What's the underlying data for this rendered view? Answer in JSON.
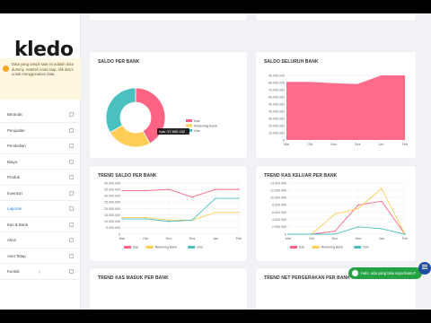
{
  "app": {
    "logo": "kledo"
  },
  "notice": {
    "text": "Data yang tampil saat ini adalah data dummy. Setelah Anda siap, klik disini untuk menggunakan data."
  },
  "sidebar": {
    "items": [
      {
        "label": "Beranda"
      },
      {
        "label": "Penjualan"
      },
      {
        "label": "Pembelian"
      },
      {
        "label": "Biaya"
      },
      {
        "label": "Produk"
      },
      {
        "label": "Inventori"
      },
      {
        "label": "Laporan",
        "active": true
      },
      {
        "label": "Kas & Bank"
      },
      {
        "label": "Akun"
      },
      {
        "label": "Aset Tetap"
      },
      {
        "label": "Kontak"
      }
    ],
    "collapse_icon": "chevron-left-icon"
  },
  "cards": {
    "saldo_per_bank": {
      "title": "SALDO PER BANK",
      "tooltip": "Kas: 37.680.152"
    },
    "saldo_seluruh_bank": {
      "title": "SALDO SELURUH BANK"
    },
    "trend_saldo_per_bank": {
      "title": "TREND SALDO PER BANK"
    },
    "trend_kas_keluar": {
      "title": "TREND KAS KELUAR PER BANK"
    },
    "trend_kas_masuk": {
      "title": "TREND KAS MASUK PER BANK"
    },
    "trend_net": {
      "title": "TREND NET PERGERAKAN PER BANK"
    }
  },
  "help": {
    "text": "Halo, ada yang bisa saya bantu?",
    "icon": "whatsapp-icon"
  },
  "fab": {
    "icon": "menu-icon"
  },
  "colors": {
    "kas": "#ff6384",
    "rekening_bank": "#ffce56",
    "giro": "#4bc0c0",
    "accent": "#1e88e5"
  },
  "chart_data": [
    {
      "type": "pie",
      "title": "SALDO PER BANK",
      "categories": [
        "Kas",
        "Rekening Bank",
        "Giro"
      ],
      "values": [
        37680152,
        22000000,
        30000000
      ]
    },
    {
      "type": "area",
      "title": "SALDO SELURUH BANK",
      "categories": [
        "Mar",
        "Okt",
        "Nov",
        "Des",
        "Jan",
        "Feb"
      ],
      "series": [
        {
          "values": [
            81000000,
            81000000,
            79000000,
            78000000,
            90000000,
            90000000
          ]
        }
      ],
      "yticks": [
        "90.000.000",
        "80.000.000",
        "70.000.000",
        "60.000.000",
        "50.000.000",
        "40.000.000",
        "30.000.000",
        "20.000.000",
        "10.000.000",
        "0"
      ],
      "ylim": [
        0,
        90000000
      ]
    },
    {
      "type": "line",
      "title": "TREND SALDO PER BANK",
      "categories": [
        "Mar",
        "Okt",
        "Nov",
        "Des",
        "Jan",
        "Feb"
      ],
      "series": [
        {
          "name": "Kas",
          "values": [
            34000000,
            34000000,
            35000000,
            29000000,
            35000000,
            35000000
          ]
        },
        {
          "name": "Rekening Bank",
          "values": [
            13000000,
            13000000,
            11000000,
            11000000,
            17000000,
            17000000
          ]
        },
        {
          "name": "Giro",
          "values": [
            12000000,
            12000000,
            10000000,
            11000000,
            28000000,
            28000000
          ]
        }
      ],
      "yticks": [
        "40.000.000",
        "35.000.000",
        "30.000.000",
        "25.000.000",
        "20.000.000",
        "15.000.000",
        "10.000.000",
        "5.000.000",
        "0"
      ],
      "ylim": [
        0,
        40000000
      ]
    },
    {
      "type": "line",
      "title": "TREND KAS KELUAR PER BANK",
      "categories": [
        "Mar",
        "Okt",
        "Nov",
        "Des",
        "Jan",
        "Feb"
      ],
      "series": [
        {
          "name": "Kas",
          "values": [
            0,
            0,
            800000,
            8000000,
            9000000,
            0
          ]
        },
        {
          "name": "Rekening Bank",
          "values": [
            0,
            0,
            5500000,
            7000000,
            12500000,
            0
          ]
        },
        {
          "name": "Giro",
          "values": [
            0,
            0,
            0,
            2000000,
            1500000,
            0
          ]
        }
      ],
      "yticks": [
        "14.000.000",
        "12.000.000",
        "10.000.000",
        "8.000.000",
        "6.000.000",
        "4.000.000",
        "2.000.000",
        "0"
      ],
      "ylim": [
        0,
        14000000
      ]
    }
  ]
}
